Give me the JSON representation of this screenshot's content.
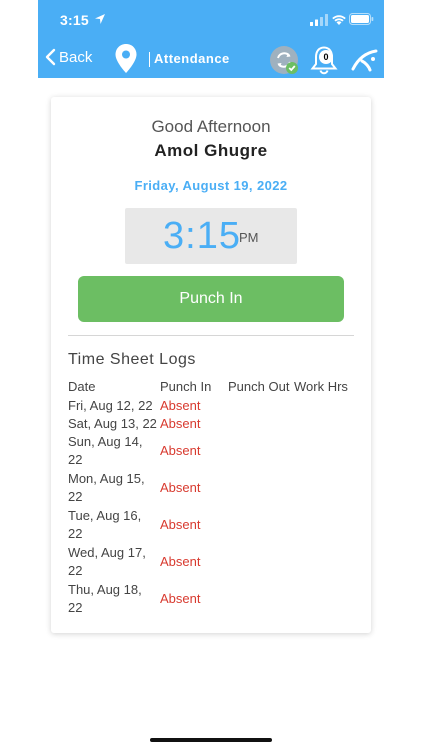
{
  "status_bar": {
    "time": "3:15"
  },
  "nav": {
    "back_label": "Back",
    "title": "Attendance",
    "notification_count": "0"
  },
  "card": {
    "greeting": "Good Afternoon",
    "user_name": "Amol Ghugre",
    "date": "Friday, August 19, 2022",
    "clock_time": "3:15",
    "clock_ampm": "PM",
    "punch_button_label": "Punch In"
  },
  "timesheet": {
    "title": "Time Sheet Logs",
    "columns": [
      "Date",
      "Punch In",
      "Punch Out",
      "Work Hrs"
    ],
    "rows": [
      {
        "date_line1": "Fri, Aug 12, 22",
        "date_line2": "",
        "punch_in": "Absent"
      },
      {
        "date_line1": "Sat, Aug 13, 22",
        "date_line2": "",
        "punch_in": "Absent"
      },
      {
        "date_line1": "Sun, Aug 14,",
        "date_line2": "22",
        "punch_in": "Absent"
      },
      {
        "date_line1": "Mon, Aug 15,",
        "date_line2": "22",
        "punch_in": "Absent"
      },
      {
        "date_line1": "Tue, Aug 16,",
        "date_line2": "22",
        "punch_in": "Absent"
      },
      {
        "date_line1": "Wed, Aug 17,",
        "date_line2": "22",
        "punch_in": "Absent"
      },
      {
        "date_line1": "Thu, Aug 18,",
        "date_line2": "22",
        "punch_in": "Absent"
      }
    ]
  },
  "colors": {
    "primary_blue": "#4aaef5",
    "punch_green": "#6cbe63",
    "absent_red": "#d83a2f"
  }
}
